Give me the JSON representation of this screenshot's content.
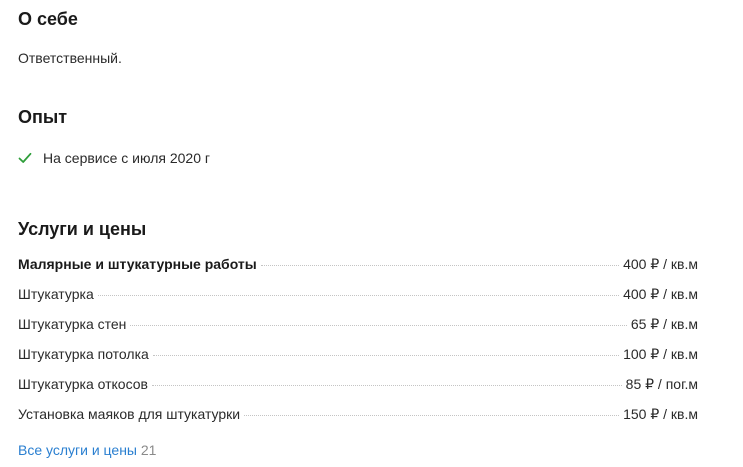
{
  "about": {
    "title": "О себе",
    "text": "Ответственный."
  },
  "experience": {
    "title": "Опыт",
    "items": [
      {
        "icon": "check-icon",
        "text": "На сервисе с июля 2020 г"
      }
    ]
  },
  "services": {
    "title": "Услуги и цены",
    "items": [
      {
        "name": "Малярные и штукатурные работы",
        "price": "400 ₽ / кв.м",
        "bold": true
      },
      {
        "name": "Штукатурка",
        "price": "400 ₽ / кв.м"
      },
      {
        "name": "Штукатурка стен",
        "price": "65 ₽ / кв.м"
      },
      {
        "name": "Штукатурка потолка",
        "price": "100 ₽ / кв.м"
      },
      {
        "name": "Штукатурка откосов",
        "price": "85 ₽ / пог.м"
      },
      {
        "name": "Установка маяков для штукатурки",
        "price": "150 ₽ / кв.м"
      }
    ],
    "all_link": "Все услуги и цены",
    "all_count": "21"
  },
  "colors": {
    "check": "#2e9e3a",
    "link": "#2a7fd0"
  }
}
